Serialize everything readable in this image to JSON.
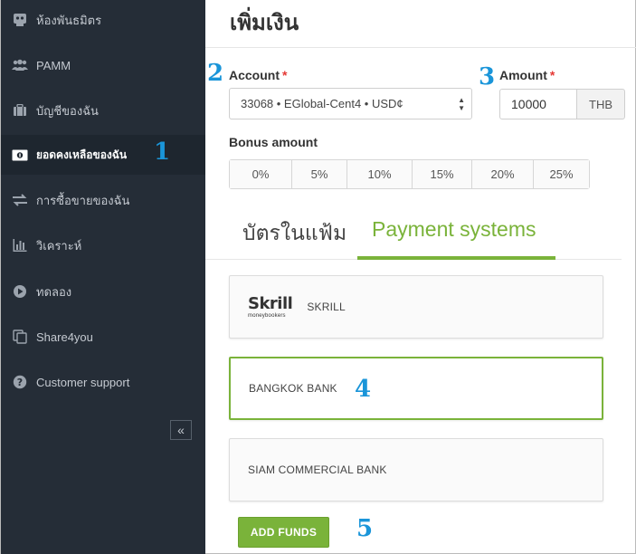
{
  "sidebar": {
    "items": [
      {
        "label": "ห้องพันธมิตร",
        "icon": "partner-room-icon"
      },
      {
        "label": "PAMM",
        "icon": "users-icon"
      },
      {
        "label": "บัญชีของฉัน",
        "icon": "briefcase-icon"
      },
      {
        "label": "ยอดคงเหลือของฉัน",
        "icon": "money-icon",
        "active": true
      },
      {
        "label": "การซื้อขายของฉัน",
        "icon": "transfer-arrows-icon"
      },
      {
        "label": "วิเคราะห์",
        "icon": "bar-chart-icon"
      },
      {
        "label": "ทดลอง",
        "icon": "play-circle-icon"
      },
      {
        "label": "Share4you",
        "icon": "copy-icon"
      },
      {
        "label": "Customer support",
        "icon": "help-icon"
      }
    ],
    "collapse_label": "«"
  },
  "annotations": [
    "1",
    "2",
    "3",
    "4",
    "5"
  ],
  "main": {
    "title": "เพิ่มเงิน",
    "account": {
      "label": "Account",
      "required_mark": "*",
      "value": "33068 • EGlobal-Cent4 • USD¢"
    },
    "amount": {
      "label": "Amount",
      "required_mark": "*",
      "value": "10000",
      "currency": "THB"
    },
    "bonus": {
      "label": "Bonus amount",
      "options": [
        "0%",
        "5%",
        "10%",
        "15%",
        "20%",
        "25%"
      ]
    },
    "tabs": [
      {
        "label": "บัตรในแฟ้ม",
        "active": false
      },
      {
        "label": "Payment systems",
        "active": true
      }
    ],
    "payment_systems": [
      {
        "name": "SKRILL",
        "logo_text": "Skrill",
        "logo_sub": "moneybookers",
        "selected": false
      },
      {
        "name": "BANGKOK BANK",
        "selected": true
      },
      {
        "name": "SIAM COMMERCIAL BANK",
        "selected": false
      }
    ],
    "add_funds_label": "ADD FUNDS"
  },
  "colors": {
    "accent": "#7ab33a",
    "sidebar_bg": "#252d37",
    "annotation": "#1a95d9",
    "required": "#e53935"
  }
}
